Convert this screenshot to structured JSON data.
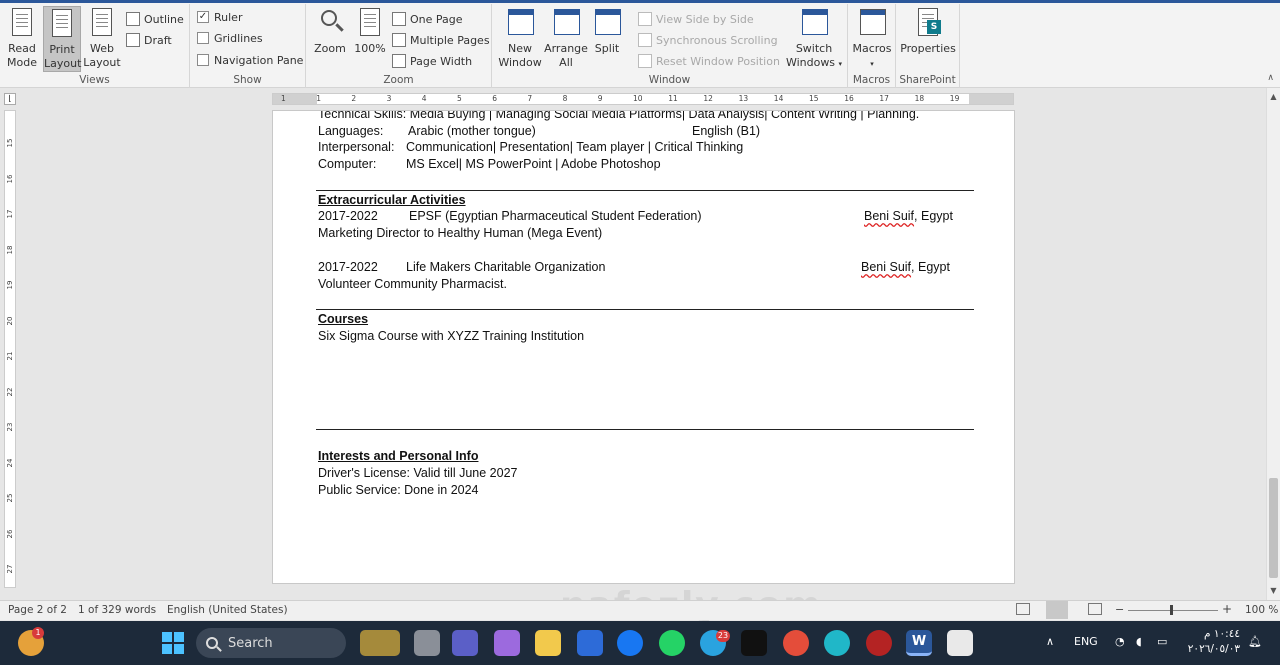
{
  "ribbon": {
    "views": {
      "label": "Views",
      "read_mode": "Read Mode",
      "print_layout": "Print Layout",
      "web_layout": "Web Layout",
      "outline": "Outline",
      "draft": "Draft"
    },
    "show": {
      "label": "Show",
      "ruler": "Ruler",
      "gridlines": "Gridlines",
      "navigation_pane": "Navigation Pane"
    },
    "zoom": {
      "label": "Zoom",
      "zoom": "Zoom",
      "percent": "100%",
      "one_page": "One Page",
      "multiple_pages": "Multiple Pages",
      "page_width": "Page Width"
    },
    "window": {
      "label": "Window",
      "new_window": "New Window",
      "arrange_all": "Arrange All",
      "split": "Split",
      "view_side_by_side": "View Side by Side",
      "synchronous_scrolling": "Synchronous Scrolling",
      "reset_window_position": "Reset Window Position",
      "switch_windows": "Switch Windows"
    },
    "macros": {
      "label": "Macros",
      "macros": "Macros"
    },
    "sharepoint": {
      "label": "SharePoint",
      "properties": "Properties"
    }
  },
  "ruler": {
    "h_ticks": [
      "1",
      "1",
      "2",
      "3",
      "4",
      "5",
      "6",
      "7",
      "8",
      "9",
      "10",
      "11",
      "12",
      "13",
      "14",
      "15",
      "16",
      "17",
      "18",
      "19"
    ],
    "v_ticks": [
      "15",
      "16",
      "17",
      "18",
      "19",
      "20",
      "21",
      "22",
      "23",
      "24",
      "25",
      "26",
      "27",
      "28"
    ]
  },
  "document": {
    "skills_line": "Technical Skills: Media Buying | Managing Social Media Platforms| Data Analysis| Content Writing | Planning.",
    "languages_label": "Languages:",
    "languages_value": "Arabic (mother tongue)",
    "languages_value2": "English (B1)",
    "interpersonal_label": "Interpersonal:",
    "interpersonal_value": "Communication| Presentation| Team player | Critical Thinking",
    "computer_label": "Computer:",
    "computer_value": "MS Excel| MS PowerPoint | Adobe Photoshop",
    "extracurricular_heading": "Extracurricular Activities",
    "act1_years": "2017-2022",
    "act1_org": "EPSF (Egyptian Pharmaceutical Student Federation)",
    "act1_city": "Beni Suif",
    "act1_country": ", Egypt",
    "act1_role": "Marketing Director to Healthy Human (Mega Event)",
    "act2_years": "2017-2022",
    "act2_org": "Life Makers Charitable Organization",
    "act2_city": "Beni Suif",
    "act2_country": ", Egypt",
    "act2_role": "Volunteer Community Pharmacist.",
    "courses_heading": "Courses",
    "course1": "Six Sigma Course with XYZZ Training Institution",
    "interests_heading": "Interests and Personal Info",
    "license": "Driver's License: Valid till June 2027",
    "public_service": "Public Service: Done in 2024"
  },
  "status": {
    "page": "Page 2 of 2",
    "words": "1 of 329 words",
    "language": "English (United States)",
    "zoom": "100 %"
  },
  "taskbar": {
    "search": "Search",
    "lang": "ENG",
    "time": "١٠:٤٤ م",
    "date": "٢٠٢٦/٠٥/٠٣",
    "notif_count": "1",
    "badge_23": "23",
    "watermark": "nafezly.com"
  },
  "colors": {
    "accent": "#2b579a",
    "taskbar": "#1d2a3a"
  }
}
